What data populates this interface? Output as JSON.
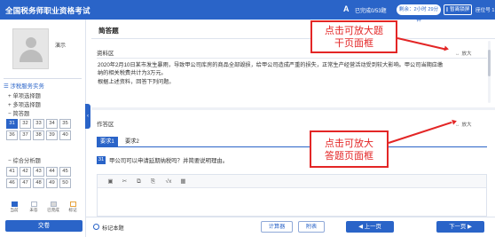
{
  "header": {
    "title": "全国税务师职业资格考试",
    "font_icon": "A",
    "done_count": "已完成0/53题",
    "timer": "剩余：2小时 29分钟",
    "pause_label": "|| 暂离锁屏",
    "seat_label": "座位号",
    "seat_number": "1"
  },
  "sidebar": {
    "candidate_name": "演示",
    "subject_link": "涉税服务实务",
    "sections": {
      "single": "单项选择题",
      "multiple": "多项选择题",
      "short_answer": "简答题",
      "comprehensive": "综合分析题"
    },
    "short_answer_numbers": [
      "31",
      "32",
      "33",
      "34",
      "35",
      "36",
      "37",
      "38",
      "39",
      "40"
    ],
    "comprehensive_numbers": [
      "41",
      "42",
      "43",
      "44",
      "45",
      "46",
      "47",
      "48",
      "49",
      "50"
    ],
    "legend": [
      "当前",
      "未答",
      "已完成",
      "标记"
    ],
    "submit_label": "交卷"
  },
  "main": {
    "question_type": "简答题",
    "material_label": "资料区",
    "material_text_line1": "2020年2月10日某市发生暴雨，导致甲公司库房的商品全部毁损，给甲公司造成严重的损失，正常生产经营活动受到较大影响。甲公司当期应缴",
    "material_text_line2": "纳的相关税费共计为3万元。",
    "material_text_line3": "根据上述资料，回答下列问题。",
    "expand_label": "放大",
    "expand_glyph": "↔",
    "answer_label": "作答区",
    "answer_tabs": [
      "要求1",
      "要求2"
    ],
    "question_number": "31",
    "question_text": "甲公司可以申请延期纳税吗？并简要说明理由。",
    "editor_tools": [
      "▣",
      "✂",
      "⧉",
      "⎘",
      "√x",
      "▦"
    ]
  },
  "bottom_bar": {
    "mark_label": "标记本题",
    "calculator_label": "计算器",
    "attachment_label": "附表",
    "prev_label": "上一页",
    "next_label": "下一页",
    "prev_glyph": "◀",
    "next_glyph": "▶"
  },
  "annotations": {
    "material_note_line1": "点击可放大题",
    "material_note_line2": "干页面框",
    "answer_note_line1": "点击可放大",
    "answer_note_line2": "答题页面框"
  },
  "colors": {
    "brand_blue": "#2a64c8",
    "annotation_red": "#e32626"
  }
}
